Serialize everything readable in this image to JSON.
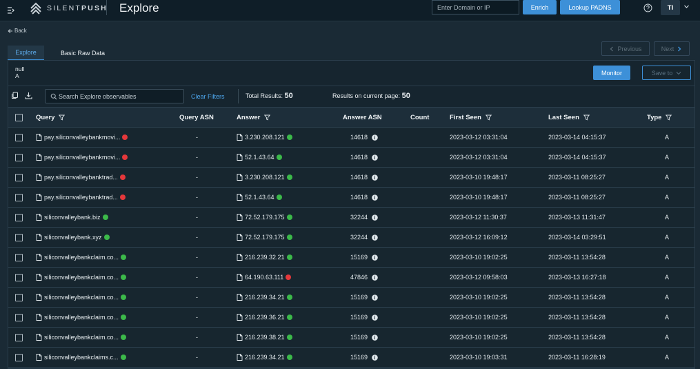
{
  "header": {
    "logo_text_light": "SILENT",
    "logo_text_bold": "PUSH",
    "page_title": "Explore",
    "domain_input_placeholder": "Enter Domain or IP",
    "enrich_label": "Enrich",
    "lookup_label": "Lookup PADNS",
    "avatar_initials": "TI"
  },
  "nav": {
    "back_label": "Back"
  },
  "tabs": [
    {
      "label": "Explore",
      "active": true
    },
    {
      "label": "Basic Raw Data",
      "active": false
    }
  ],
  "pager": {
    "previous_label": "Previous",
    "next_label": "Next"
  },
  "record": {
    "name": "null",
    "type": "A"
  },
  "actions": {
    "monitor_label": "Monitor",
    "save_to_label": "Save to"
  },
  "toolbar": {
    "search_placeholder": "Search Explore observables",
    "clear_filters_label": "Clear Filters",
    "total_results_label": "Total Results:",
    "total_results_value": "50",
    "page_results_label": "Results on current page:",
    "page_results_value": "50"
  },
  "colors": {
    "accent": "#3d90d8",
    "status_good": "#3cb94a",
    "status_bad": "#e5383b"
  },
  "table": {
    "columns": {
      "query": "Query",
      "query_asn": "Query ASN",
      "answer": "Answer",
      "answer_asn": "Answer ASN",
      "count": "Count",
      "first_seen": "First Seen",
      "last_seen": "Last Seen",
      "type": "Type"
    },
    "rows": [
      {
        "query": "pay.siliconvalleybankmovi...",
        "query_status": "bad",
        "query_asn": "-",
        "answer": "3.230.208.121",
        "answer_status": "good",
        "answer_asn": "14618",
        "count": "",
        "first_seen": "2023-03-12 03:31:04",
        "last_seen": "2023-03-14 04:15:37",
        "type": "A"
      },
      {
        "query": "pay.siliconvalleybankmovi...",
        "query_status": "bad",
        "query_asn": "-",
        "answer": "52.1.43.64",
        "answer_status": "good",
        "answer_asn": "14618",
        "count": "",
        "first_seen": "2023-03-12 03:31:04",
        "last_seen": "2023-03-14 04:15:37",
        "type": "A"
      },
      {
        "query": "pay.siliconvalleybanktrad...",
        "query_status": "bad",
        "query_asn": "-",
        "answer": "3.230.208.121",
        "answer_status": "good",
        "answer_asn": "14618",
        "count": "",
        "first_seen": "2023-03-10 19:48:17",
        "last_seen": "2023-03-11 08:25:27",
        "type": "A"
      },
      {
        "query": "pay.siliconvalleybanktrad...",
        "query_status": "bad",
        "query_asn": "-",
        "answer": "52.1.43.64",
        "answer_status": "good",
        "answer_asn": "14618",
        "count": "",
        "first_seen": "2023-03-10 19:48:17",
        "last_seen": "2023-03-11 08:25:27",
        "type": "A"
      },
      {
        "query": "siliconvalleybank.biz",
        "query_status": "good",
        "query_asn": "-",
        "answer": "72.52.179.175",
        "answer_status": "good",
        "answer_asn": "32244",
        "count": "",
        "first_seen": "2023-03-12 11:30:37",
        "last_seen": "2023-03-13 11:31:47",
        "type": "A"
      },
      {
        "query": "siliconvalleybank.xyz",
        "query_status": "good",
        "query_asn": "-",
        "answer": "72.52.179.175",
        "answer_status": "good",
        "answer_asn": "32244",
        "count": "",
        "first_seen": "2023-03-12 16:09:12",
        "last_seen": "2023-03-14 03:29:51",
        "type": "A"
      },
      {
        "query": "siliconvalleybankclaim.co...",
        "query_status": "good",
        "query_asn": "-",
        "answer": "216.239.32.21",
        "answer_status": "good",
        "answer_asn": "15169",
        "count": "",
        "first_seen": "2023-03-10 19:02:25",
        "last_seen": "2023-03-11 13:54:28",
        "type": "A"
      },
      {
        "query": "siliconvalleybankclaim.co...",
        "query_status": "good",
        "query_asn": "-",
        "answer": "64.190.63.111",
        "answer_status": "bad",
        "answer_asn": "47846",
        "count": "",
        "first_seen": "2023-03-12 09:58:03",
        "last_seen": "2023-03-13 16:27:18",
        "type": "A"
      },
      {
        "query": "siliconvalleybankclaim.co...",
        "query_status": "good",
        "query_asn": "-",
        "answer": "216.239.34.21",
        "answer_status": "good",
        "answer_asn": "15169",
        "count": "",
        "first_seen": "2023-03-10 19:02:25",
        "last_seen": "2023-03-11 13:54:28",
        "type": "A"
      },
      {
        "query": "siliconvalleybankclaim.co...",
        "query_status": "good",
        "query_asn": "-",
        "answer": "216.239.36.21",
        "answer_status": "good",
        "answer_asn": "15169",
        "count": "",
        "first_seen": "2023-03-10 19:02:25",
        "last_seen": "2023-03-11 13:54:28",
        "type": "A"
      },
      {
        "query": "siliconvalleybankclaim.co...",
        "query_status": "good",
        "query_asn": "-",
        "answer": "216.239.38.21",
        "answer_status": "good",
        "answer_asn": "15169",
        "count": "",
        "first_seen": "2023-03-10 19:02:25",
        "last_seen": "2023-03-11 13:54:28",
        "type": "A"
      },
      {
        "query": "siliconvalleybankclaims.c...",
        "query_status": "good",
        "query_asn": "-",
        "answer": "216.239.34.21",
        "answer_status": "good",
        "answer_asn": "15169",
        "count": "",
        "first_seen": "2023-03-10 19:03:31",
        "last_seen": "2023-03-11 16:28:19",
        "type": "A"
      }
    ]
  }
}
